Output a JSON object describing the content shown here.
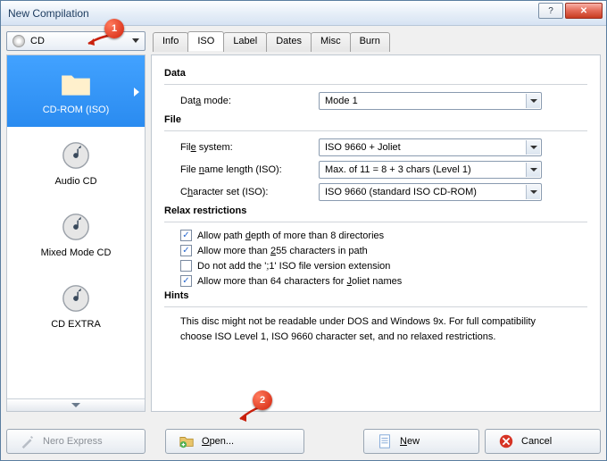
{
  "window": {
    "title": "New Compilation"
  },
  "markers": {
    "m1": "1",
    "m2": "2"
  },
  "disc_selector": {
    "label": "CD"
  },
  "tabs": {
    "info": "Info",
    "iso": "ISO",
    "label": "Label",
    "dates": "Dates",
    "misc": "Misc",
    "burn": "Burn"
  },
  "types": {
    "cdrom_iso": "CD-ROM (ISO)",
    "audio_cd": "Audio CD",
    "mixed_mode": "Mixed Mode CD",
    "cd_extra": "CD EXTRA"
  },
  "sections": {
    "data": "Data",
    "file": "File",
    "relax": "Relax restrictions",
    "hints": "Hints"
  },
  "fields": {
    "data_mode": {
      "label_pre": "Dat",
      "label_u": "a",
      "label_post": " mode:",
      "value": "Mode 1"
    },
    "file_system": {
      "label_pre": "Fil",
      "label_u": "e",
      "label_post": " system:",
      "value": "ISO 9660 + Joliet"
    },
    "name_len": {
      "label_pre": "File ",
      "label_u": "n",
      "label_post": "ame length (ISO):",
      "value": "Max. of 11 = 8 + 3 chars (Level 1)"
    },
    "charset": {
      "label_pre": "C",
      "label_u": "h",
      "label_post": "aracter set (ISO):",
      "value": "ISO 9660 (standard ISO CD-ROM)"
    }
  },
  "checks": {
    "depth": {
      "checked": true,
      "pre": "Allow path ",
      "u": "d",
      "post": "epth of more than 8 directories"
    },
    "path255": {
      "checked": true,
      "pre": "Allow more than ",
      "u": "2",
      "post": "55 characters in path"
    },
    "noext": {
      "checked": false,
      "pre": "Do not add the '",
      "u": ";",
      "post": "1' ISO file version extension"
    },
    "joliet64": {
      "checked": true,
      "pre": "Allow more than 64 characters for ",
      "u": "J",
      "post": "oliet names"
    }
  },
  "hints": {
    "text": "This disc might not be readable under DOS and Windows 9x. For full compatibility choose ISO Level 1, ISO 9660 character set, and no relaxed restrictions."
  },
  "buttons": {
    "nero_express": "Nero Express",
    "open": "Open...",
    "open_u": "O",
    "open_post": "pen...",
    "new": "New",
    "new_u": "N",
    "new_post": "ew",
    "cancel": "Cancel"
  }
}
